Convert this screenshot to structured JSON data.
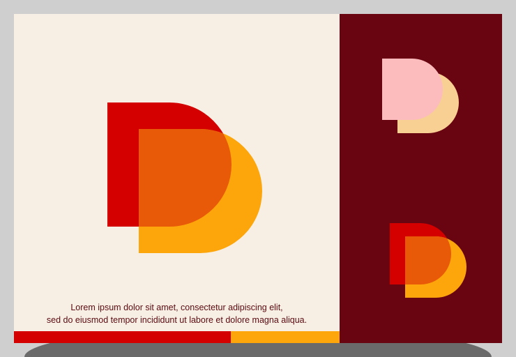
{
  "tagline": {
    "line1": "Lorem ipsum dolor sit amet, consectetur adipiscing elit,",
    "line2": "sed do eiusmod tempor incididunt ut labore et dolore magna aliqua."
  },
  "colors": {
    "background": "#cfcfcf",
    "shadow": "#6a6a6a",
    "cream_panel": "#f7efe4",
    "maroon_panel": "#690510",
    "red": "#d40000",
    "orange_overlap": "#e85a08",
    "amber": "#fca60c",
    "pink": "#fcbcbe",
    "peach": "#f8d093",
    "tagline_text": "#5a0a10"
  },
  "logos": [
    {
      "name": "primary-logo",
      "back_color": "red",
      "front_color": "amber",
      "overlap_color": "orange_overlap"
    },
    {
      "name": "pastel-logo",
      "back_color": "pink",
      "front_color": "peach"
    },
    {
      "name": "small-color-logo",
      "back_color": "red",
      "front_color": "amber",
      "overlap_color": "orange_overlap"
    }
  ]
}
